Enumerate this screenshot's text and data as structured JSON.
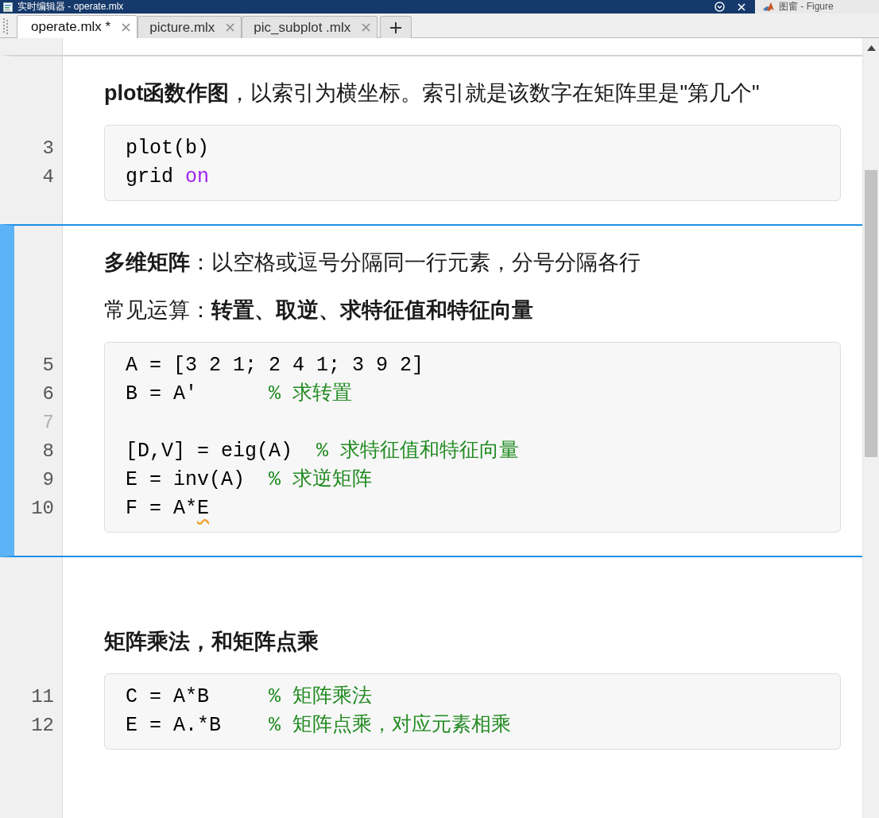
{
  "window": {
    "title": "实时编辑器 - operate.mlx"
  },
  "other_window": {
    "title": "图窗 - Figure"
  },
  "tabs": [
    {
      "label": "operate.mlx *",
      "selected": true
    },
    {
      "label": "picture.mlx",
      "selected": false
    },
    {
      "label": "pic_subplot .mlx",
      "selected": false
    }
  ],
  "sections": [
    {
      "selected": false,
      "cells": [
        {
          "kind": "text",
          "text": "**plot函数作图**，以索引为横坐标。索引就是该数字在矩阵里是\"第几个\""
        },
        {
          "kind": "code",
          "lines": [
            {
              "number": "3",
              "tokens": [
                {
                  "kind": "plain",
                  "text": "plot(b)"
                }
              ]
            },
            {
              "number": "4",
              "tokens": [
                {
                  "kind": "plain",
                  "text": "grid "
                },
                {
                  "kind": "keyword",
                  "text": "on"
                }
              ]
            }
          ]
        }
      ]
    },
    {
      "selected": true,
      "cells": [
        {
          "kind": "text",
          "text": "**多维矩阵**：以空格或逗号分隔同一行元素，分号分隔各行"
        },
        {
          "kind": "text",
          "text": "常见运算：**转置、取逆、求特征值和特征向量**"
        },
        {
          "kind": "code",
          "lines": [
            {
              "number": "5",
              "tokens": [
                {
                  "kind": "plain",
                  "text": "A = [3 2 1; 2 4 1; 3 9 2]"
                }
              ]
            },
            {
              "number": "6",
              "tokens": [
                {
                  "kind": "plain",
                  "text": "B = A'      "
                },
                {
                  "kind": "comment",
                  "text": "% 求转置"
                }
              ]
            },
            {
              "number": "7"
            },
            {
              "number": "8",
              "tokens": [
                {
                  "kind": "plain",
                  "text": "[D,V] = eig(A)  "
                },
                {
                  "kind": "comment",
                  "text": "% 求特征值和特征向量"
                }
              ]
            },
            {
              "number": "9",
              "tokens": [
                {
                  "kind": "plain",
                  "text": "E = inv(A)  "
                },
                {
                  "kind": "comment",
                  "text": "% 求逆矩阵"
                }
              ]
            },
            {
              "number": "10",
              "tokens": [
                {
                  "kind": "plain",
                  "text": "F = A*"
                },
                {
                  "kind": "warning",
                  "text": "E"
                }
              ]
            }
          ]
        }
      ]
    },
    {
      "selected": false,
      "cells": [
        {
          "kind": "heading",
          "text": "矩阵乘法，和矩阵点乘"
        },
        {
          "kind": "code",
          "lines": [
            {
              "number": "11",
              "tokens": [
                {
                  "kind": "plain",
                  "text": "C = A*B     "
                },
                {
                  "kind": "comment",
                  "text": "% 矩阵乘法"
                }
              ]
            },
            {
              "number": "12",
              "tokens": [
                {
                  "kind": "plain",
                  "text": "E = A.*B    "
                },
                {
                  "kind": "comment",
                  "text": "% 矩阵点乘，对应元素相乘"
                }
              ]
            }
          ]
        }
      ]
    }
  ]
}
